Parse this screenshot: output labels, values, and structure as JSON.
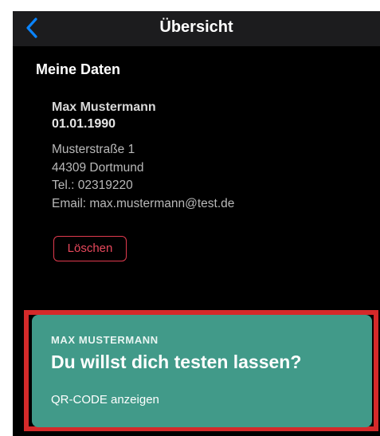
{
  "navbar": {
    "title": "Übersicht",
    "back_icon": "chevron-left-icon"
  },
  "section": {
    "title": "Meine Daten"
  },
  "person": {
    "name": "Max Mustermann",
    "birthdate": "01.01.1990",
    "street": "Musterstraße 1",
    "city": "44309 Dortmund",
    "phone": "Tel.: 02319220",
    "email": "Email: max.mustermann@test.de"
  },
  "actions": {
    "delete_label": "Löschen"
  },
  "test_card": {
    "eyebrow": "MAX MUSTERMANN",
    "headline": "Du willst dich testen lassen?",
    "qr_label": "QR-CODE anzeigen"
  },
  "colors": {
    "background": "#000000",
    "navbar": "#1c1c1e",
    "accent_blue": "#0a84ff",
    "delete_red": "#e03a4e",
    "card_green": "#419a89",
    "highlight_red": "#d42a2a"
  }
}
